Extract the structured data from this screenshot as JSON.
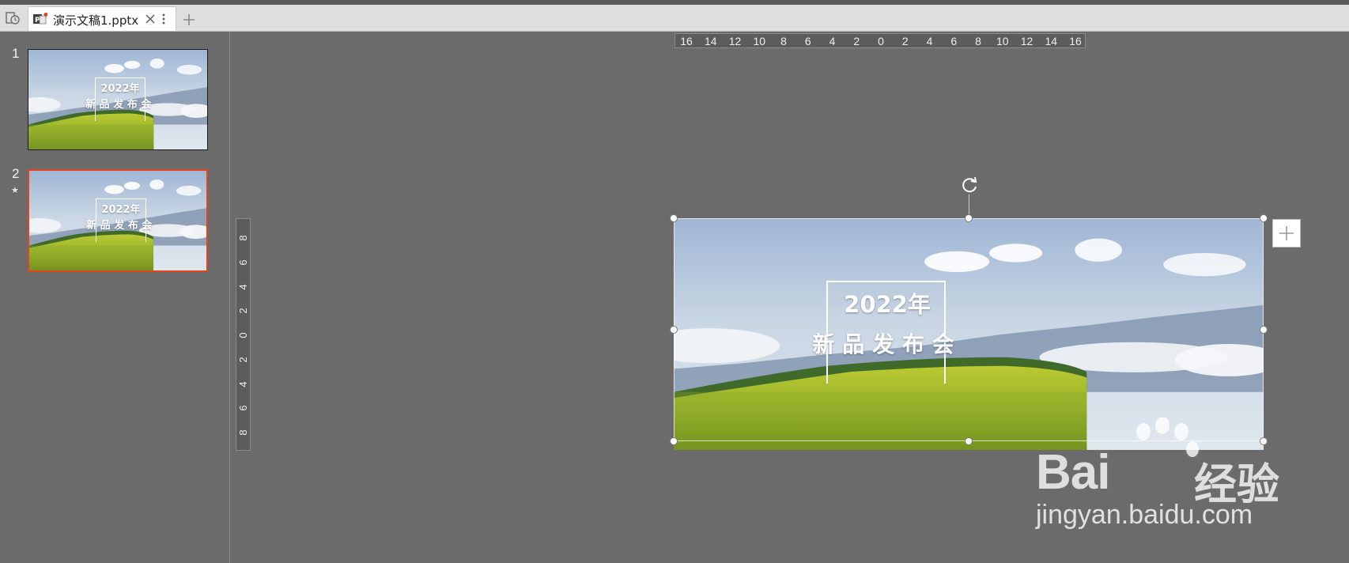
{
  "tabs": [
    {
      "title": "演示文稿1.pptx",
      "active": true
    }
  ],
  "slides_panel": {
    "slides": [
      {
        "number": "1",
        "selected": false,
        "has_animation": false
      },
      {
        "number": "2",
        "selected": true,
        "has_animation": true
      }
    ]
  },
  "slide_content": {
    "title_line1": "2022年",
    "title_line2": "新品发布会"
  },
  "rulers": {
    "horizontal": [
      "16",
      "14",
      "12",
      "10",
      "8",
      "6",
      "4",
      "2",
      "0",
      "2",
      "4",
      "6",
      "8",
      "10",
      "12",
      "14",
      "16"
    ],
    "vertical": [
      "8",
      "6",
      "4",
      "2",
      "0",
      "2",
      "4",
      "6",
      "8"
    ]
  },
  "watermark": {
    "brand_text": "Bai",
    "brand_cn": "经验",
    "url": "jingyan.baidu.com"
  },
  "colors": {
    "canvas_bg": "#6b6b6b",
    "selected_slide_border": "#e0451f",
    "tab_bar": "#dedede"
  },
  "icons": [
    "home-icon",
    "ppt-file-icon",
    "close-icon",
    "more-icon",
    "add-tab-icon",
    "rotate-icon",
    "plus-icon",
    "animation-star-icon"
  ]
}
